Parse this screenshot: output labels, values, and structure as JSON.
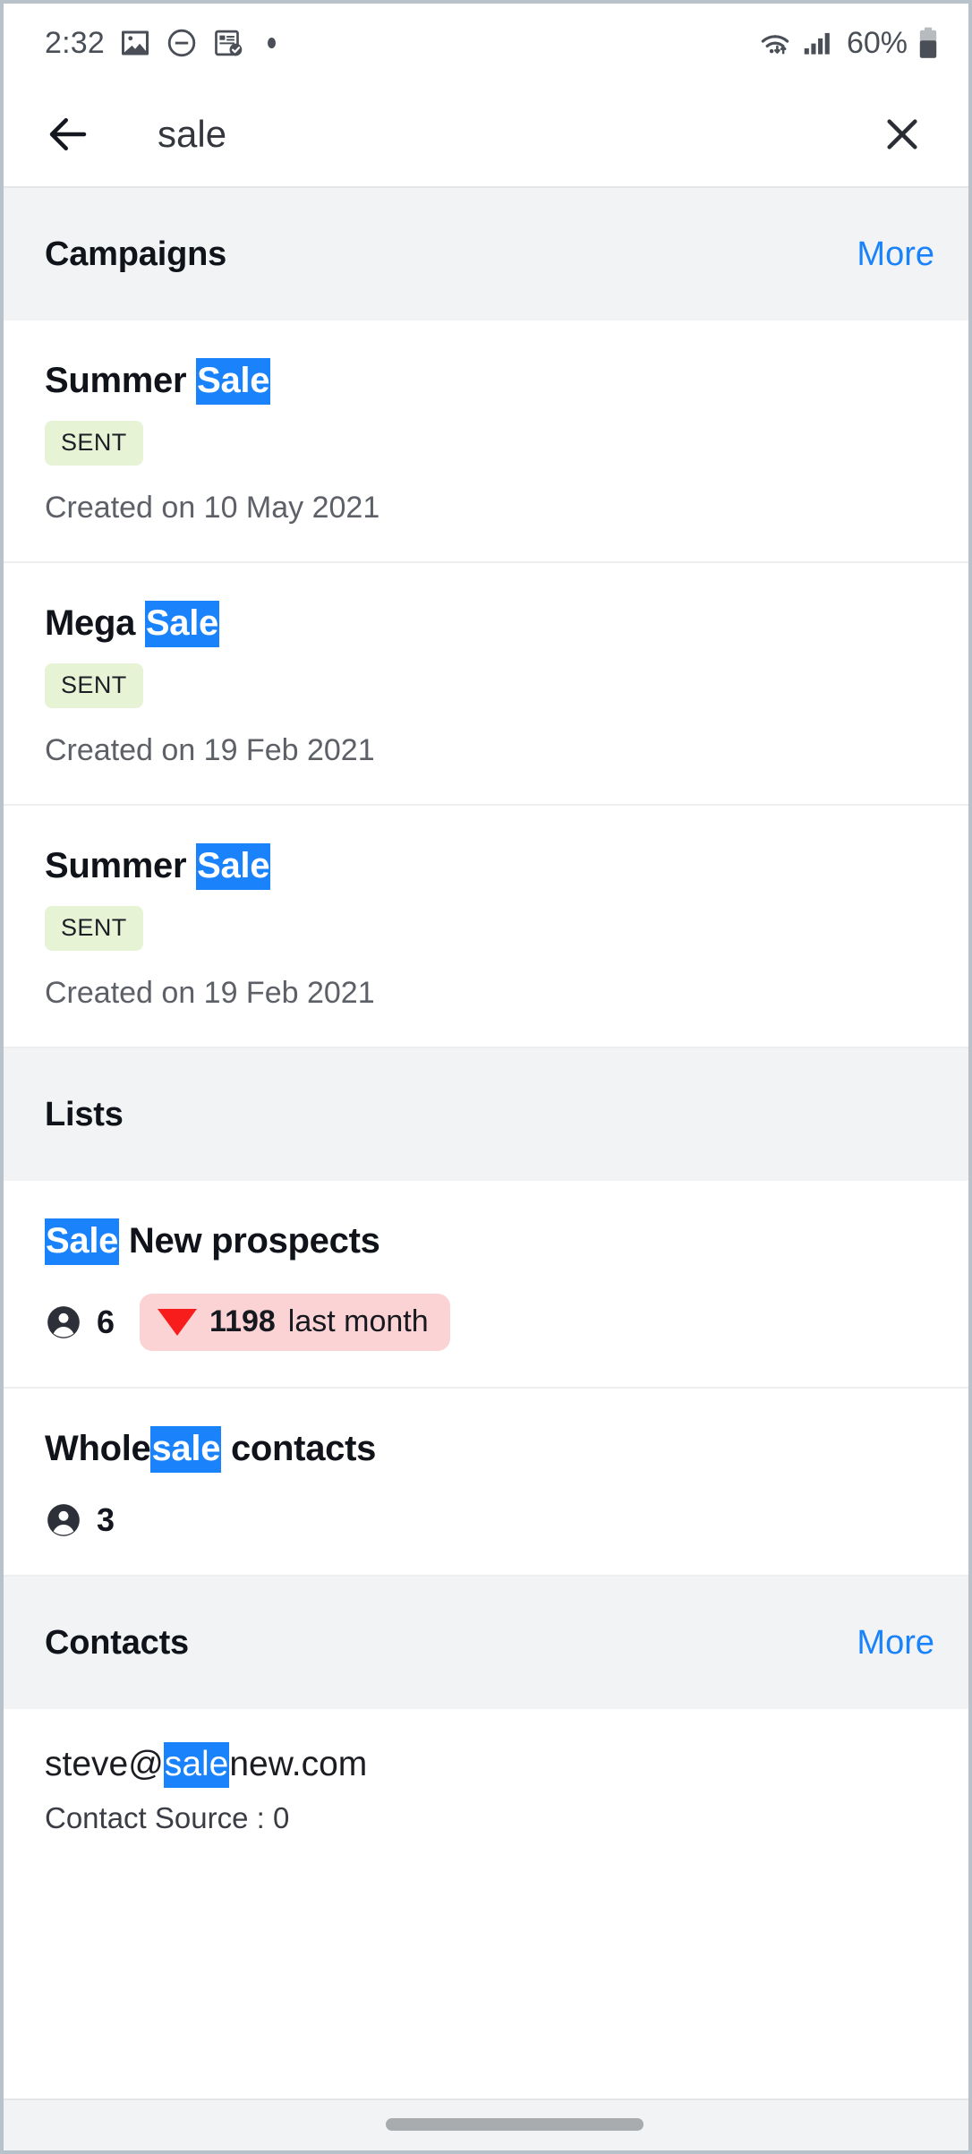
{
  "status_bar": {
    "time": "2:32",
    "battery_percent": "60%",
    "icons": [
      "image-icon",
      "do-not-disturb-icon",
      "form-check-icon",
      "dot-icon",
      "wifi-icon",
      "signal-icon",
      "battery-icon"
    ]
  },
  "search": {
    "query": "sale",
    "back_icon": "back-arrow-icon",
    "close_icon": "close-icon"
  },
  "colors": {
    "highlight": "#1a82fb",
    "link": "#1a82fb",
    "badge_sent_bg": "#e6f3d5",
    "trend_down_bg": "#fbd3d4",
    "trend_down_arrow": "#f81d1d",
    "section_bg": "#f1f3f4"
  },
  "sections": [
    {
      "title": "Campaigns",
      "more_label": "More",
      "has_more": true,
      "rows": [
        {
          "title_pre": "Summer ",
          "title_highlight": "Sale",
          "title_post": "",
          "status": "SENT",
          "subtitle": "Created on 10 May 2021"
        },
        {
          "title_pre": "Mega ",
          "title_highlight": "Sale",
          "title_post": "",
          "status": "SENT",
          "subtitle": "Created on 19 Feb 2021"
        },
        {
          "title_pre": "Summer ",
          "title_highlight": "Sale",
          "title_post": "",
          "status": "SENT",
          "subtitle": "Created on 19 Feb 2021"
        }
      ]
    },
    {
      "title": "Lists",
      "more_label": "",
      "has_more": false,
      "rows": [
        {
          "title_pre": "",
          "title_highlight": "Sale",
          "title_post": " New prospects",
          "contact_count": "6",
          "trend_direction": "down",
          "trend_value": "1198",
          "trend_label": " last month"
        },
        {
          "title_pre": "Whole",
          "title_highlight": "sale",
          "title_post": " contacts",
          "contact_count": "3"
        }
      ]
    },
    {
      "title": "Contacts",
      "more_label": "More",
      "has_more": true,
      "rows": [
        {
          "title_pre": "steve@",
          "title_highlight": "sale",
          "title_post": "new.com",
          "subtitle": "Contact Source : 0"
        }
      ]
    }
  ]
}
